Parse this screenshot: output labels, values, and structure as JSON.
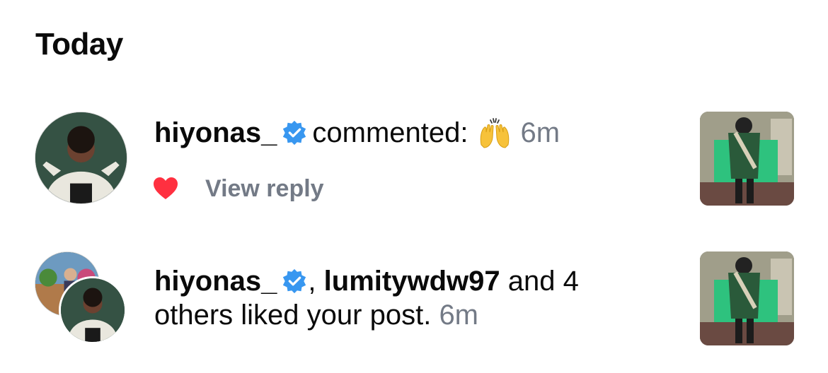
{
  "section": {
    "title": "Today"
  },
  "notifications": [
    {
      "username": "hiyonas_",
      "action": "commented:",
      "emoji": "raising-hands",
      "time": "6m",
      "liked": true,
      "view_reply": "View reply"
    },
    {
      "username1": "hiyonas_",
      "separator": ",",
      "username2": "lumitywdw97",
      "and_text": "and 4",
      "rest_text": "others liked your post.",
      "time": "6m"
    }
  ],
  "colors": {
    "verified": "#3897f0",
    "heart": "#ff3040",
    "muted": "#737a86"
  }
}
